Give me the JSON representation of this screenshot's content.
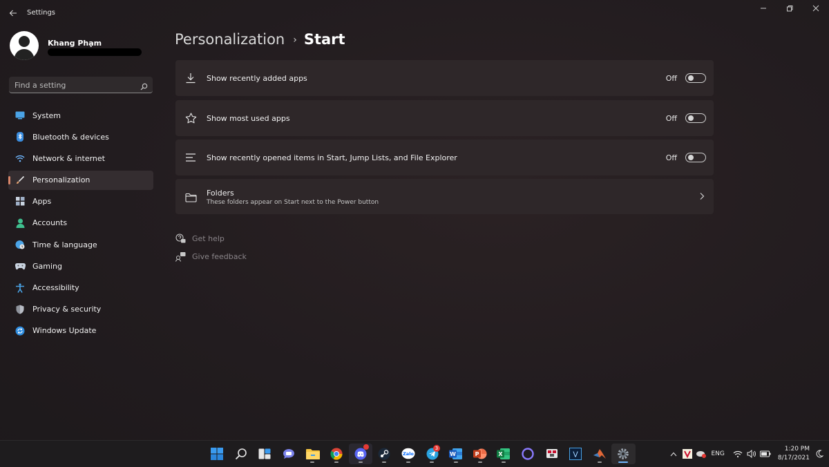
{
  "window": {
    "title": "Settings",
    "controls": [
      "minimize",
      "restore",
      "close"
    ]
  },
  "profile": {
    "name": "Khang Phạm"
  },
  "search": {
    "placeholder": "Find a setting"
  },
  "sidebar": {
    "items": [
      {
        "label": "System",
        "icon": "monitor-icon",
        "color": "#4aa3e6"
      },
      {
        "label": "Bluetooth & devices",
        "icon": "bluetooth-icon",
        "color": "#3b8ee0"
      },
      {
        "label": "Network & internet",
        "icon": "wifi-icon",
        "color": "#6fb7ff"
      },
      {
        "label": "Personalization",
        "icon": "brush-icon",
        "color": "#e0a070",
        "active": true
      },
      {
        "label": "Apps",
        "icon": "apps-icon",
        "color": "#c9d3e0"
      },
      {
        "label": "Accounts",
        "icon": "person-icon",
        "color": "#3fbf8f"
      },
      {
        "label": "Time & language",
        "icon": "globe-clock-icon",
        "color": "#4aa3e6"
      },
      {
        "label": "Gaming",
        "icon": "gamepad-icon",
        "color": "#c9d3e0"
      },
      {
        "label": "Accessibility",
        "icon": "accessibility-icon",
        "color": "#4aa3e6"
      },
      {
        "label": "Privacy & security",
        "icon": "shield-icon",
        "color": "#b8bcc4"
      },
      {
        "label": "Windows Update",
        "icon": "update-icon",
        "color": "#2f8de0"
      }
    ]
  },
  "breadcrumb": {
    "parent": "Personalization",
    "separator": "›",
    "current": "Start"
  },
  "settings": {
    "recently_added": {
      "label": "Show recently added apps",
      "state": "Off",
      "icon": "download-icon"
    },
    "most_used": {
      "label": "Show most used apps",
      "state": "Off",
      "icon": "star-icon"
    },
    "recently_opened": {
      "label": "Show recently opened items in Start, Jump Lists, and File Explorer",
      "state": "Off",
      "icon": "list-icon"
    },
    "folders": {
      "label": "Folders",
      "description": "These folders appear on Start next to the Power button",
      "icon": "folder-icon"
    }
  },
  "help": {
    "get_help": "Get help",
    "give_feedback": "Give feedback"
  },
  "taskbar": {
    "apps": [
      {
        "icon": "windows-start-icon"
      },
      {
        "icon": "search-icon"
      },
      {
        "icon": "task-view-icon"
      },
      {
        "icon": "teams-chat-icon"
      },
      {
        "icon": "file-explorer-icon",
        "running": true
      },
      {
        "icon": "chrome-icon",
        "running": true
      },
      {
        "icon": "discord-icon",
        "running": true
      },
      {
        "icon": "steam-icon",
        "running": true
      },
      {
        "icon": "zalo-icon",
        "label": "Zalo",
        "running": true
      },
      {
        "icon": "telegram-icon",
        "badge": "3",
        "running": true
      },
      {
        "icon": "word-icon",
        "label": "W",
        "running": true
      },
      {
        "icon": "powerpoint-icon",
        "label": "P",
        "running": true
      },
      {
        "icon": "excel-icon",
        "label": "X",
        "running": true
      },
      {
        "icon": "cortana-icon"
      },
      {
        "icon": "snipping-icon"
      },
      {
        "icon": "vegas-icon",
        "label": "V"
      },
      {
        "icon": "matlab-icon",
        "running": true
      },
      {
        "icon": "settings-gear-icon",
        "running": true,
        "active": true
      }
    ],
    "tray": {
      "language": "ENG",
      "time": "1:20 PM",
      "date": "8/17/2021"
    }
  }
}
